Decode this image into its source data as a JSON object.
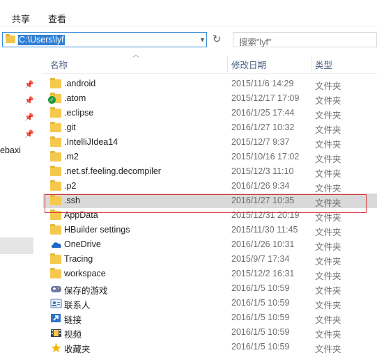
{
  "window": {
    "title_fragment": "lyf"
  },
  "ribbon": {
    "tabs": [
      "共享",
      "查看"
    ]
  },
  "address": {
    "path": "C:\\Users\\lyf",
    "search_placeholder": "搜索\"lyf\""
  },
  "nav": {
    "text": "ebaxi"
  },
  "columns": {
    "name": "名称",
    "date": "修改日期",
    "type": "类型"
  },
  "files": [
    {
      "name": ".android",
      "date": "2015/11/6 14:29",
      "type": "文件夹",
      "icon": "folder-icon"
    },
    {
      "name": ".atom",
      "date": "2015/12/17 17:09",
      "type": "文件夹",
      "icon": "folder-sync-icon"
    },
    {
      "name": ".eclipse",
      "date": "2016/1/25 17:44",
      "type": "文件夹",
      "icon": "folder-icon"
    },
    {
      "name": ".git",
      "date": "2016/1/27 10:32",
      "type": "文件夹",
      "icon": "folder-icon"
    },
    {
      "name": ".IntelliJIdea14",
      "date": "2015/12/7 9:37",
      "type": "文件夹",
      "icon": "folder-icon"
    },
    {
      "name": ".m2",
      "date": "2015/10/16 17:02",
      "type": "文件夹",
      "icon": "folder-icon"
    },
    {
      "name": ".net.sf.feeling.decompiler",
      "date": "2015/12/3 11:10",
      "type": "文件夹",
      "icon": "folder-icon"
    },
    {
      "name": ".p2",
      "date": "2016/1/26 9:34",
      "type": "文件夹",
      "icon": "folder-icon"
    },
    {
      "name": ".ssh",
      "date": "2016/1/27 10:35",
      "type": "文件夹",
      "icon": "folder-icon",
      "selected": true
    },
    {
      "name": "AppData",
      "date": "2015/12/31 20:19",
      "type": "文件夹",
      "icon": "folder-icon"
    },
    {
      "name": "HBuilder settings",
      "date": "2015/11/30 11:45",
      "type": "文件夹",
      "icon": "folder-icon"
    },
    {
      "name": "OneDrive",
      "date": "2016/1/26 10:31",
      "type": "文件夹",
      "icon": "onedrive-icon"
    },
    {
      "name": "Tracing",
      "date": "2015/9/7 17:34",
      "type": "文件夹",
      "icon": "folder-icon"
    },
    {
      "name": "workspace",
      "date": "2015/12/2 16:31",
      "type": "文件夹",
      "icon": "folder-icon"
    },
    {
      "name": "保存的游戏",
      "date": "2016/1/5 10:59",
      "type": "文件夹",
      "icon": "saved-games-icon"
    },
    {
      "name": "联系人",
      "date": "2016/1/5 10:59",
      "type": "文件夹",
      "icon": "contacts-icon"
    },
    {
      "name": "链接",
      "date": "2016/1/5 10:59",
      "type": "文件夹",
      "icon": "links-icon"
    },
    {
      "name": "视频",
      "date": "2016/1/5 10:59",
      "type": "文件夹",
      "icon": "videos-icon"
    },
    {
      "name": "收藏夹",
      "date": "2016/1/5 10:59",
      "type": "文件夹",
      "icon": "favorites-icon"
    }
  ]
}
